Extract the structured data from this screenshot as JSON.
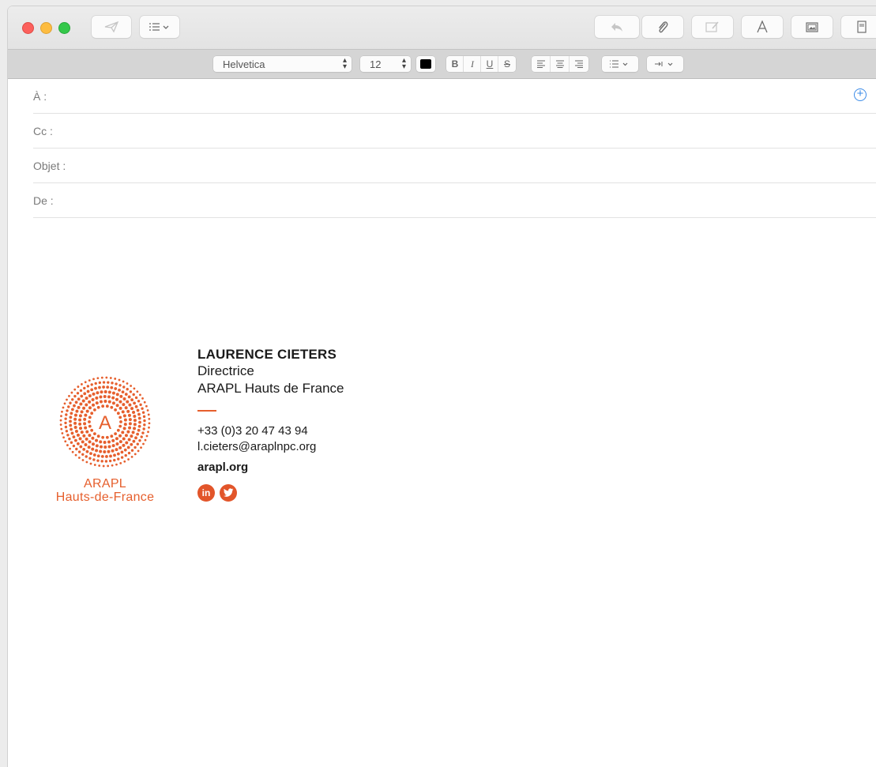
{
  "window": {
    "format_bar": {
      "font_family": "Helvetica",
      "font_size": "12",
      "text_color": "#000000"
    }
  },
  "header_fields": {
    "to_label": "À :",
    "cc_label": "Cc :",
    "subject_label": "Objet :",
    "from_label": "De :"
  },
  "signature": {
    "logo_line1": "ARAPL",
    "logo_line2": "Hauts-de-France",
    "logo_letter": "A",
    "name": "LAURENCE CIETERS",
    "title": "Directrice",
    "organization": "ARAPL Hauts de France",
    "phone": "+33 (0)3 20 47 43 94",
    "email": "l.cieters@araplnpc.org",
    "website": "arapl.org",
    "social": [
      "linkedin-icon",
      "twitter-icon"
    ],
    "accent_color": "#e65f2d"
  },
  "icons": {
    "add_contact": "plus-circle-icon",
    "send": "paper-plane-icon",
    "header_options": "list-icon",
    "reply": "reply-icon",
    "attach": "paperclip-icon",
    "markup": "markup-icon",
    "format": "font-icon",
    "photo": "photo-icon",
    "template": "template-icon"
  }
}
